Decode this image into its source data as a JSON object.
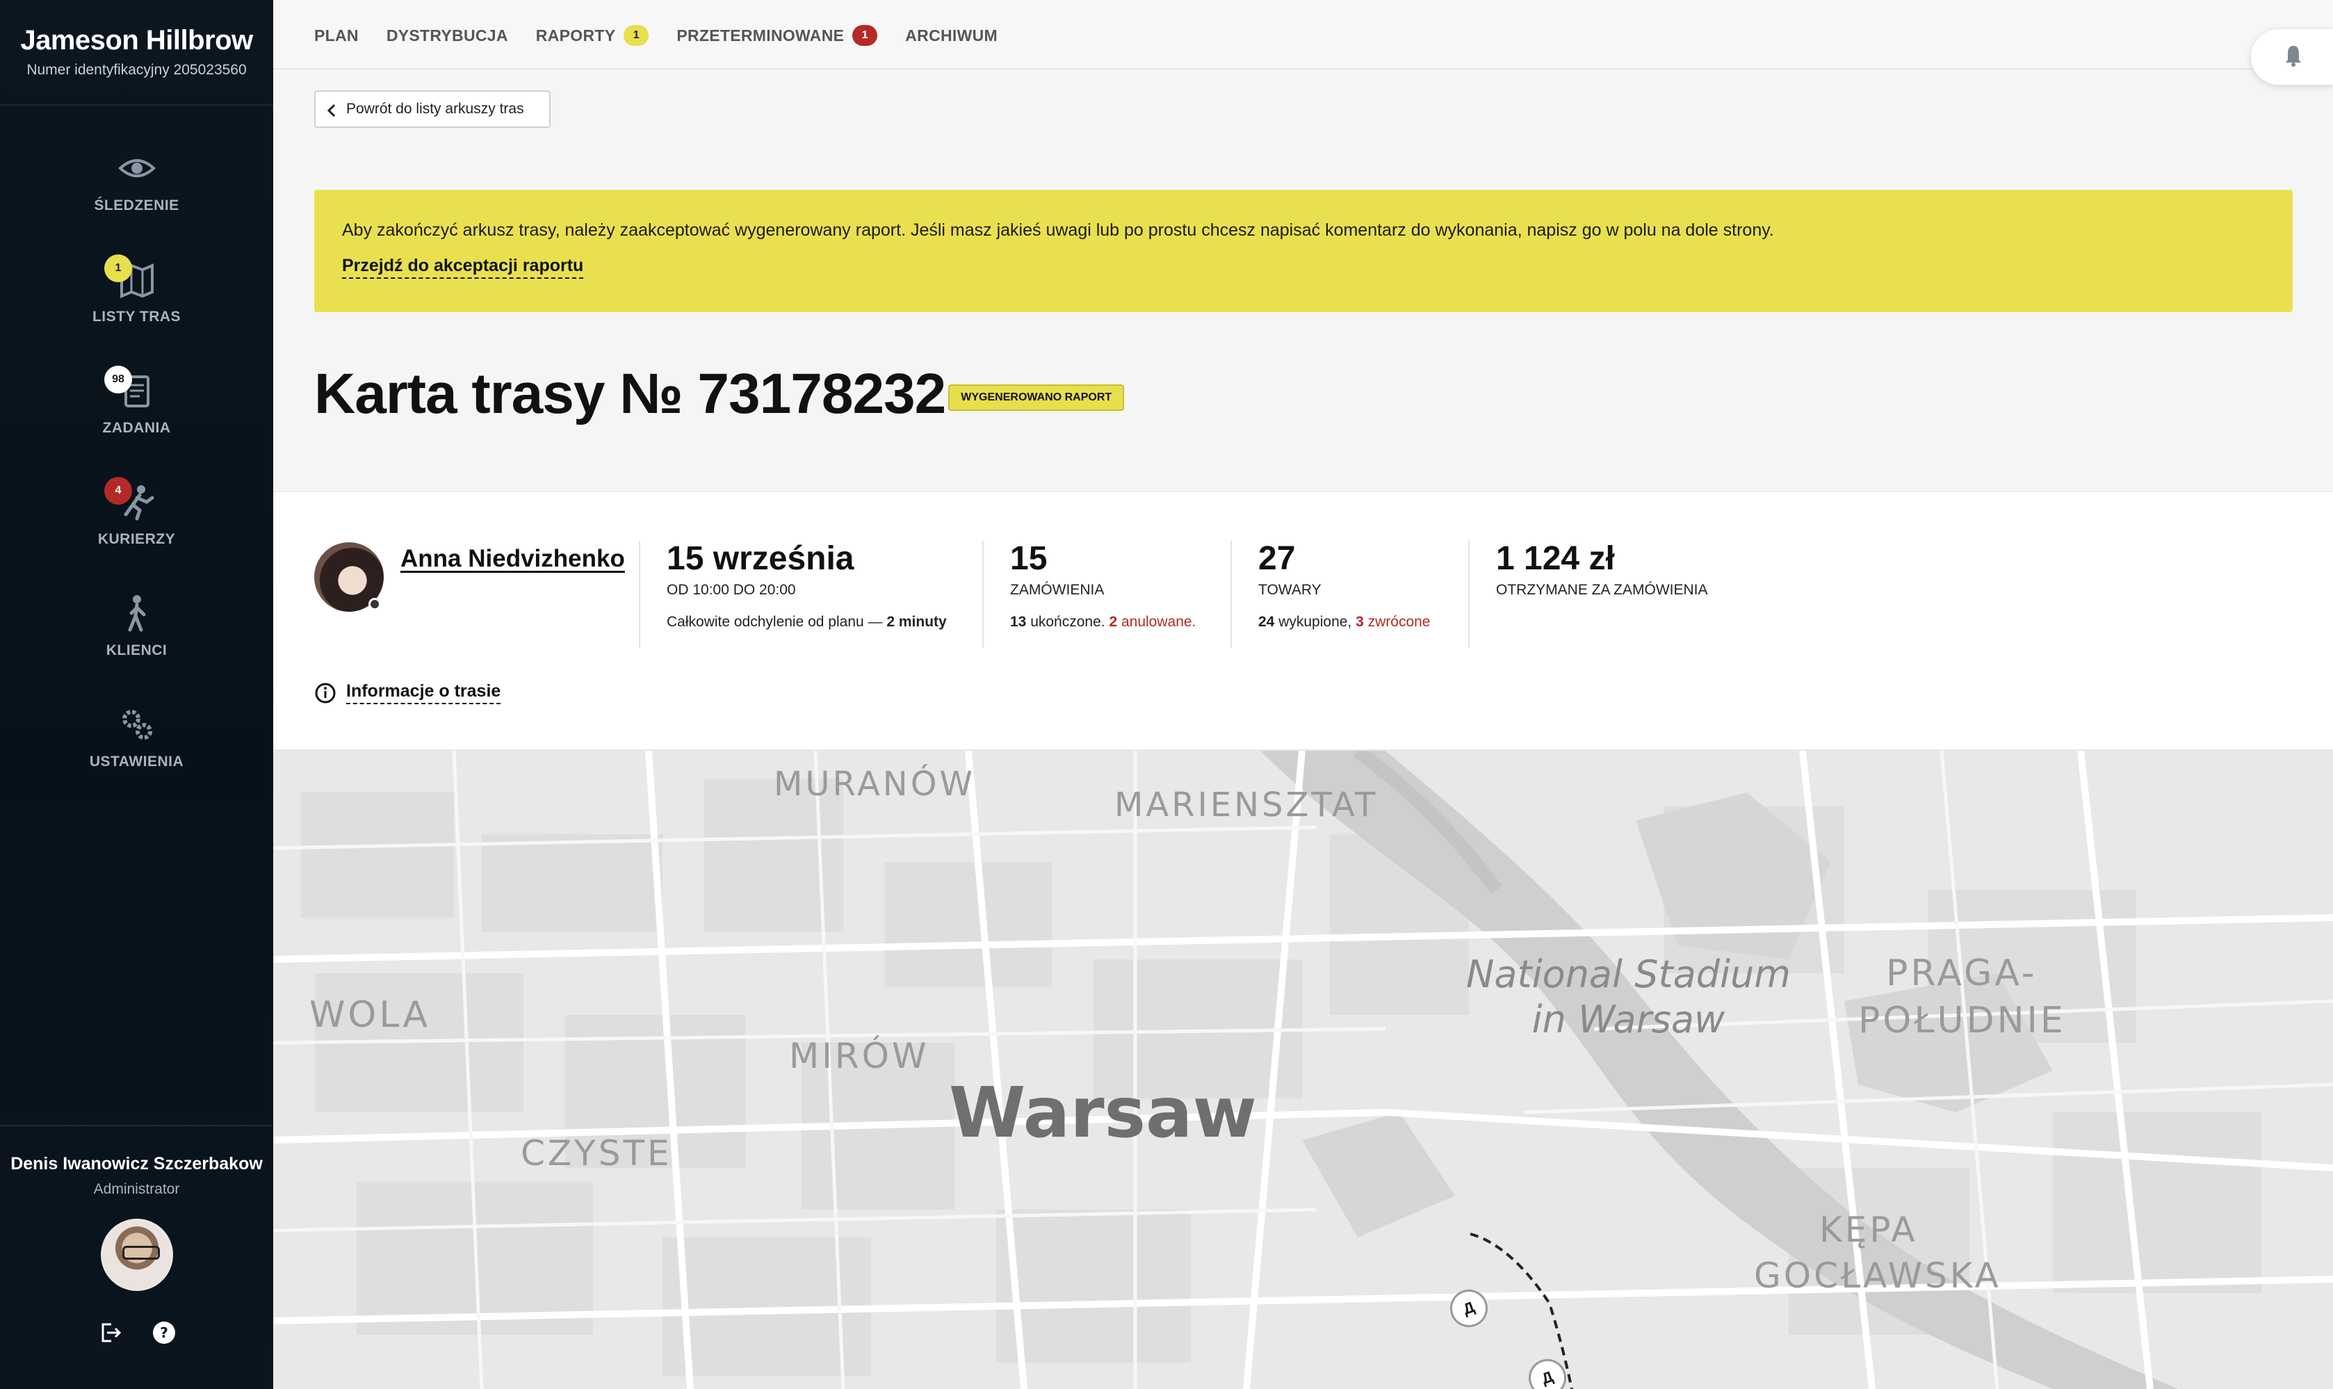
{
  "sidebar": {
    "brand_name": "Jameson Hillbrow",
    "brand_id": "Numer identyfikacyjny 205023560",
    "items": [
      {
        "label": "ŚLEDZENIE",
        "icon": "eye-icon",
        "badge": ""
      },
      {
        "label": "LISTY TRAS",
        "icon": "map-icon",
        "badge": "1"
      },
      {
        "label": "ZADANIA",
        "icon": "clipboard-icon",
        "badge": "98"
      },
      {
        "label": "KURIERZY",
        "icon": "runner-icon",
        "badge": "4"
      },
      {
        "label": "KLIENCI",
        "icon": "person-walking-icon",
        "badge": ""
      },
      {
        "label": "USTAWIENIA",
        "icon": "gears-icon",
        "badge": ""
      }
    ],
    "user": {
      "name": "Denis Iwanowicz Szczerbakow",
      "role": "Administrator"
    }
  },
  "tabs": [
    {
      "label": "PLAN",
      "count": ""
    },
    {
      "label": "DYSTRYBUCJA",
      "count": ""
    },
    {
      "label": "RAPORTY",
      "count": "1"
    },
    {
      "label": "PRZETERMINOWANE",
      "count": "1"
    },
    {
      "label": "ARCHIWUM",
      "count": ""
    }
  ],
  "back_button": "Powrót do listy arkuszy tras",
  "alert": {
    "text": "Aby zakończyć arkusz trasy, należy zaakceptować wygenerowany raport. Jeśli masz jakieś uwagi lub po prostu chcesz napisać komentarz do wykonania, napisz go w polu na dole strony.",
    "link": "Przejdź do akceptacji raportu"
  },
  "page": {
    "title": "Karta trasy № 73178232",
    "status": "WYGENEROWANO RAPORT"
  },
  "courier": {
    "name": "Anna Niedvizhenko"
  },
  "stats": {
    "date": {
      "big": "15 września",
      "sub": "OD 10:00 DO 20:00",
      "note_prefix": "Całkowite odchylenie od planu — ",
      "note_value": "2 minuty"
    },
    "orders": {
      "big": "15",
      "sub": "ZAMÓWIENIA",
      "done_num": "13",
      "done_label": " ukończone. ",
      "cancel_num": "2",
      "cancel_label": " anulowane."
    },
    "goods": {
      "big": "27",
      "sub": "TOWARY",
      "bought_num": "24",
      "bought_label": " wykupione, ",
      "return_num": "3",
      "return_label": " zwrócone"
    },
    "money": {
      "big": "1 124 zł",
      "sub": "OTRZYMANE ZA ZAMÓWIENIA"
    }
  },
  "route_info": "Informacje o trasie",
  "map": {
    "labels": [
      "MURANÓW",
      "MARIENSZTAT",
      "WOLA",
      "MIRÓW",
      "CZYSTE",
      "PRAGA-",
      "POŁUDNIE",
      "KĘPA",
      "GOCŁAWSKA"
    ],
    "city": "Warsaw",
    "poi_line1": "National Stadium",
    "poi_line2": "in Warsaw",
    "marker": "Д"
  },
  "colors": {
    "accent_yellow": "#e9e050",
    "danger_red": "#b32a28",
    "sidebar_bg": "#071119"
  }
}
